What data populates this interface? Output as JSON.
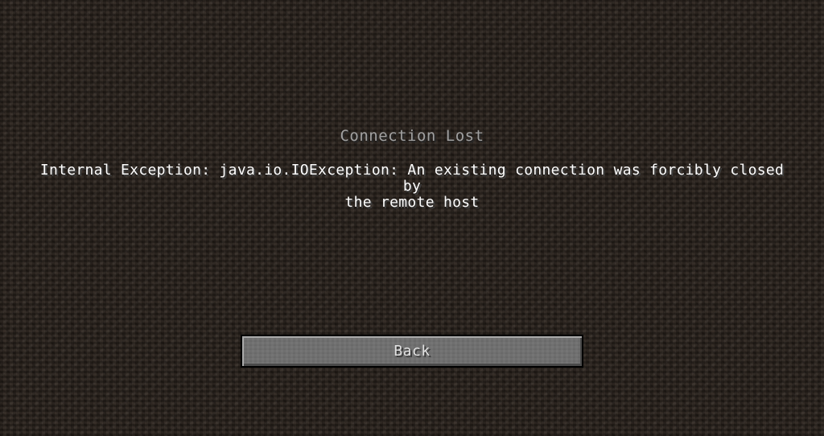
{
  "screen": {
    "title": "Connection Lost",
    "message_line1": "Internal Exception: java.io.IOException: An existing connection was forcibly closed by",
    "message_line2": "the remote host",
    "back_button_label": "Back"
  },
  "colors": {
    "background": "#2c241e",
    "title_text": "#a0a0a0",
    "message_text": "#ffffff",
    "button_face": "#6f6f6f",
    "button_text": "#e0e0e0"
  }
}
